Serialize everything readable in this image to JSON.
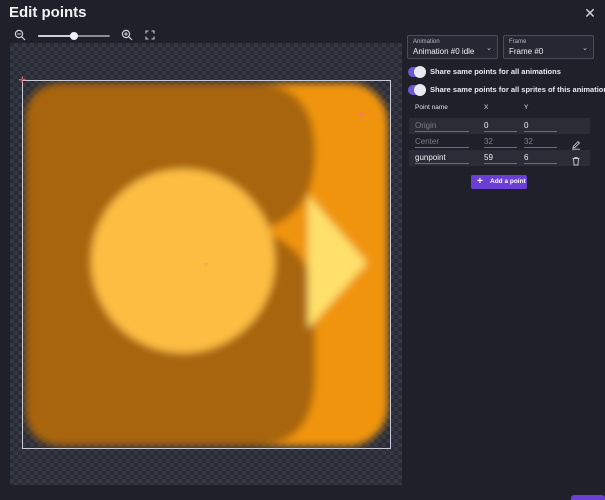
{
  "dialog": {
    "title": "Edit points",
    "close_icon": "close-icon"
  },
  "zoom": {
    "level": 0.5,
    "icons": [
      "zoom-out-icon",
      "zoom-in-icon",
      "fit-screen-icon"
    ]
  },
  "animation_select": {
    "label": "Animation",
    "value": "Animation #0 idle"
  },
  "frame_select": {
    "label": "Frame",
    "value": "Frame #0"
  },
  "toggles": [
    {
      "label": "Share same points for all animations",
      "checked": true
    },
    {
      "label": "Share same points for all sprites of this animation",
      "checked": true
    }
  ],
  "points_table": {
    "headers": {
      "name": "Point name",
      "x": "X",
      "y": "Y"
    },
    "rows": [
      {
        "name": "Origin",
        "x": "0",
        "y": "0"
      },
      {
        "name": "Center",
        "x": "32",
        "y": "32"
      },
      {
        "name": "gunpoint",
        "x": "59",
        "y": "6"
      }
    ]
  },
  "add_point": {
    "label": "Add a point",
    "icon": "plus-icon"
  },
  "colors": {
    "accent": "#6a3fd6",
    "toggle": "#6f59d8",
    "background": "#1f2029",
    "point_marker": "#ff6f7d"
  }
}
